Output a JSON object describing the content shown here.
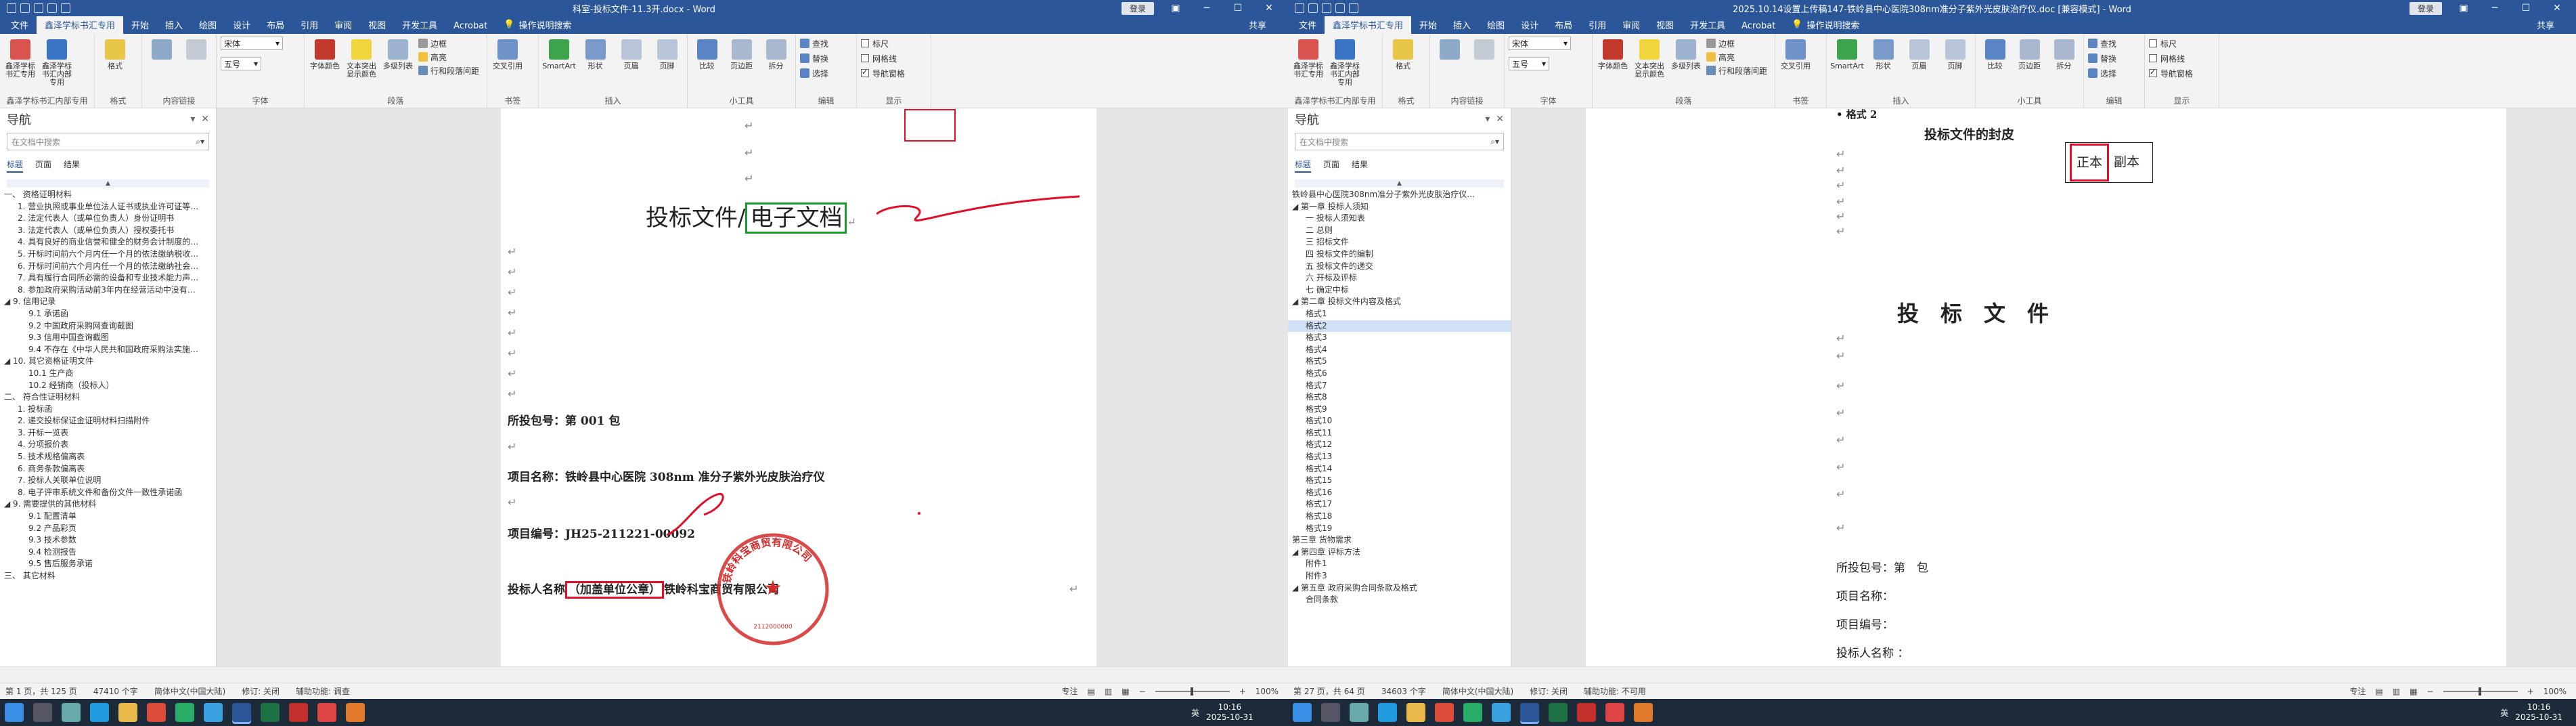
{
  "left": {
    "title": "科室-投标文件-11.3开.docx - Word",
    "login": "登录",
    "share": "共享",
    "tabs": [
      "文件",
      "鑫泽学标书汇专用",
      "开始",
      "插入",
      "绘图",
      "设计",
      "布局",
      "引用",
      "审阅",
      "视图",
      "开发工具",
      "Acrobat"
    ],
    "tell_me": "操作说明搜索",
    "ribbon": {
      "addin_btn1": "鑫泽学标书汇专用",
      "addin_btn2": "鑫泽学标书汇内部专用",
      "addin_group": "鑫泽学标书汇内部专用",
      "format_group": "格式",
      "content_group": "内容链接",
      "font_name": "宋体",
      "font_size": "五号",
      "font_group": "字体",
      "para_group": "段落",
      "border_label": "边框",
      "hl_label": "高亮",
      "linegap_label": "行和段落间距",
      "char_color": "字体颜色",
      "text_highlight": "文本突出显示颜色",
      "multi_level": "多级列表",
      "cross_ref": "交叉引用",
      "smartart": "SmartArt",
      "shape": "形状",
      "header": "页眉",
      "footer": "页脚",
      "insert_group": "插入",
      "compare": "比较",
      "page_break": "页边距",
      "split": "拆分",
      "tools_group": "小工具",
      "find": "查找",
      "replace": "替换",
      "select": "选择",
      "edit_group": "编辑",
      "ruler": "标尺",
      "gridlines": "网格线",
      "navpane": "导航窗格",
      "show_group": "显示",
      "book_group": "书签"
    },
    "nav": {
      "title": "导航",
      "search_placeholder": "在文档中搜索",
      "tab_headings": "标题",
      "tab_pages": "页面",
      "tab_results": "结果",
      "headings": [
        {
          "level": 1,
          "text": "一、 资格证明材料",
          "sel": false
        },
        {
          "level": 2,
          "text": "1. 营业执照或事业单位法人证书或执业许可证等…",
          "sel": false
        },
        {
          "level": 2,
          "text": "2. 法定代表人（或单位负责人）身份证明书",
          "sel": false
        },
        {
          "level": 2,
          "text": "3. 法定代表人（或单位负责人）授权委托书",
          "sel": false
        },
        {
          "level": 2,
          "text": "4. 具有良好的商业信誉和健全的财务会计制度的…",
          "sel": false
        },
        {
          "level": 2,
          "text": "5. 开标时间前六个月内任一个月的依法缴纳税收…",
          "sel": false
        },
        {
          "level": 2,
          "text": "6. 开标时间前六个月内任一个月的依法缴纳社会…",
          "sel": false
        },
        {
          "level": 2,
          "text": "7. 具有履行合同所必需的设备和专业技术能力声…",
          "sel": false
        },
        {
          "level": 2,
          "text": "8. 参加政府采购活动前3年内在经营活动中没有…",
          "sel": false
        },
        {
          "level": 1,
          "text": "◢ 9. 信用记录",
          "sel": false
        },
        {
          "level": 3,
          "text": "9.1 承诺函",
          "sel": false
        },
        {
          "level": 3,
          "text": "9.2 中国政府采购网查询截图",
          "sel": false
        },
        {
          "level": 3,
          "text": "9.3 信用中国查询截图",
          "sel": false
        },
        {
          "level": 3,
          "text": "9.4 不存在《中华人民共和国政府采购法实施…",
          "sel": false
        },
        {
          "level": 1,
          "text": "◢ 10. 其它资格证明文件",
          "sel": false
        },
        {
          "level": 3,
          "text": "10.1 生产商",
          "sel": false
        },
        {
          "level": 3,
          "text": "10.2 经销商（投标人）",
          "sel": false
        },
        {
          "level": 1,
          "text": "二、 符合性证明材料",
          "sel": false
        },
        {
          "level": 2,
          "text": "1. 投标函",
          "sel": false
        },
        {
          "level": 2,
          "text": "2. 递交投标保证金证明材料扫描附件",
          "sel": false
        },
        {
          "level": 2,
          "text": "3. 开标一览表",
          "sel": false
        },
        {
          "level": 2,
          "text": "4. 分项报价表",
          "sel": false
        },
        {
          "level": 2,
          "text": "5. 技术规格偏离表",
          "sel": false
        },
        {
          "level": 2,
          "text": "6. 商务条款偏离表",
          "sel": false
        },
        {
          "level": 2,
          "text": "7. 投标人关联单位说明",
          "sel": false
        },
        {
          "level": 2,
          "text": "8. 电子评审系统文件和备份文件一致性承诺函",
          "sel": false
        },
        {
          "level": 1,
          "text": "◢ 9. 需要提供的其他材料",
          "sel": false
        },
        {
          "level": 3,
          "text": "9.1 配置清单",
          "sel": false
        },
        {
          "level": 3,
          "text": "9.2 产品彩页",
          "sel": false
        },
        {
          "level": 3,
          "text": "9.3 技术参数",
          "sel": false
        },
        {
          "level": 3,
          "text": "9.4 检测报告",
          "sel": false
        },
        {
          "level": 3,
          "text": "9.5 售后服务承诺",
          "sel": false
        },
        {
          "level": 1,
          "text": "三、 其它材料",
          "sel": false
        }
      ]
    },
    "doc": {
      "title_part1": "投标文件/",
      "title_part2": "电子文档",
      "package": "所投包号：第 001 包",
      "project_name": "项目名称：铁岭县中心医院 308nm 准分子紫外光皮肤治疗仪",
      "project_no": "项目编号：JH25-211221-00092",
      "bidder_label": "投标人名称",
      "bidder_box": "（加盖单位公章）",
      "bidder_value": "铁岭科宝商贸有限公司",
      "seal_text": "铁岭科宝商贸有限公司",
      "seal_no": "2112000000"
    },
    "status": {
      "page": "第 1 页，共 125 页",
      "words": "47410 个字",
      "lang": "简体中文(中国大陆)",
      "track": "修订: 关闭",
      "access": "辅助功能: 调查",
      "focus": "专注",
      "zoom": "100%"
    }
  },
  "right": {
    "title": "2025.10.14设置上传稿147-铁岭县中心医院308nm准分子紫外光皮肤治疗仪.doc [兼容模式] - Word",
    "login": "登录",
    "share": "共享",
    "tabs": [
      "文件",
      "鑫泽学标书汇专用",
      "开始",
      "插入",
      "绘图",
      "设计",
      "布局",
      "引用",
      "审阅",
      "视图",
      "开发工具",
      "Acrobat"
    ],
    "tell_me": "操作说明搜索",
    "nav": {
      "title": "导航",
      "search_placeholder": "在文档中搜索",
      "tab_headings": "标题",
      "tab_pages": "页面",
      "tab_results": "结果",
      "headings": [
        {
          "level": 1,
          "text": "铁岭县中心医院308nm准分子紫外光皮肤治疗仪…",
          "sel": false
        },
        {
          "level": 1,
          "text": "◢ 第一章 投标人须知",
          "sel": false
        },
        {
          "level": 2,
          "text": "一 投标人须知表",
          "sel": false
        },
        {
          "level": 2,
          "text": "二 总则",
          "sel": false
        },
        {
          "level": 2,
          "text": "三 招标文件",
          "sel": false
        },
        {
          "level": 2,
          "text": "四 投标文件的编制",
          "sel": false
        },
        {
          "level": 2,
          "text": "五 投标文件的递交",
          "sel": false
        },
        {
          "level": 2,
          "text": "六 开标及评标",
          "sel": false
        },
        {
          "level": 2,
          "text": "七 确定中标",
          "sel": false
        },
        {
          "level": 1,
          "text": "◢ 第二章 投标文件内容及格式",
          "sel": false
        },
        {
          "level": 2,
          "text": "格式1",
          "sel": false
        },
        {
          "level": 2,
          "text": "格式2",
          "sel": true
        },
        {
          "level": 2,
          "text": "格式3",
          "sel": false
        },
        {
          "level": 2,
          "text": "格式4",
          "sel": false
        },
        {
          "level": 2,
          "text": "格式5",
          "sel": false
        },
        {
          "level": 2,
          "text": "格式6",
          "sel": false
        },
        {
          "level": 2,
          "text": "格式7",
          "sel": false
        },
        {
          "level": 2,
          "text": "格式8",
          "sel": false
        },
        {
          "level": 2,
          "text": "格式9",
          "sel": false
        },
        {
          "level": 2,
          "text": "格式10",
          "sel": false
        },
        {
          "level": 2,
          "text": "格式11",
          "sel": false
        },
        {
          "level": 2,
          "text": "格式12",
          "sel": false
        },
        {
          "level": 2,
          "text": "格式13",
          "sel": false
        },
        {
          "level": 2,
          "text": "格式14",
          "sel": false
        },
        {
          "level": 2,
          "text": "格式15",
          "sel": false
        },
        {
          "level": 2,
          "text": "格式16",
          "sel": false
        },
        {
          "level": 2,
          "text": "格式17",
          "sel": false
        },
        {
          "level": 2,
          "text": "格式18",
          "sel": false
        },
        {
          "level": 2,
          "text": "格式19",
          "sel": false
        },
        {
          "level": 1,
          "text": "第三章 货物需求",
          "sel": false
        },
        {
          "level": 1,
          "text": "◢ 第四章 评标方法",
          "sel": false
        },
        {
          "level": 2,
          "text": "附件1",
          "sel": false
        },
        {
          "level": 2,
          "text": "附件3",
          "sel": false
        },
        {
          "level": 1,
          "text": "◢ 第五章 政府采购合同条款及格式",
          "sel": false
        },
        {
          "level": 2,
          "text": "合同条款",
          "sel": false
        }
      ]
    },
    "doc": {
      "format_label": "• 格式 2",
      "cover_title": "投标文件的封皮",
      "original_label": "正本",
      "copy_label": "副本",
      "big_title": "投　标　文　件",
      "package": "所投包号：第　包",
      "project_name": "项目名称：",
      "project_no": "项目编号：",
      "bidder": "投标人名称 ："
    },
    "status": {
      "page": "第 27 页，共 64 页",
      "words": "34603 个字",
      "lang": "简体中文(中国大陆)",
      "track": "修订: 关闭",
      "access": "辅助功能: 不可用",
      "focus": "专注",
      "zoom": "100%"
    }
  },
  "taskbar": {
    "time_left": "10:16",
    "date_left": "2025-10-31",
    "time_right": "10:16",
    "date_right": "2025-10-31",
    "ime": "英"
  },
  "colors": {
    "word_blue": "#2b579a",
    "annot_red": "#e0102b",
    "annot_green": "#1a9a2a",
    "seal_red": "#d42a2a"
  }
}
